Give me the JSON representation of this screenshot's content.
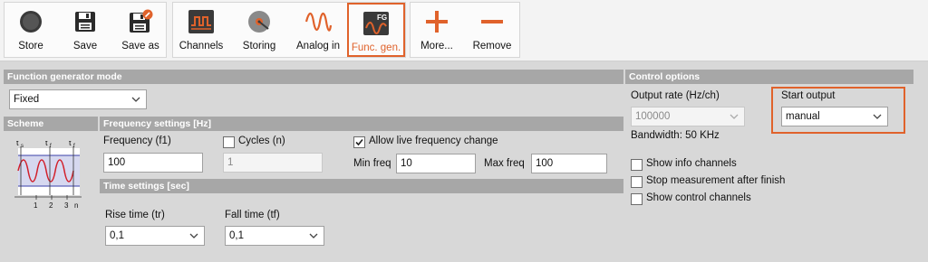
{
  "toolbar": {
    "store": "Store",
    "save": "Save",
    "save_as": "Save as",
    "channels": "Channels",
    "storing": "Storing",
    "analog_in": "Analog in",
    "func_gen": "Func. gen.",
    "func_gen_badge": "FG",
    "more": "More...",
    "remove": "Remove"
  },
  "fg_mode": {
    "title": "Function generator mode",
    "value": "Fixed"
  },
  "scheme": {
    "title": "Scheme",
    "labels": {
      "ts": "t",
      "ts_sub": "s",
      "tf": "t",
      "tf_sub": "f",
      "tf2": "t",
      "tf2_sub": "f",
      "n1": "1",
      "n2": "2",
      "n3": "3",
      "n": "n"
    }
  },
  "freq": {
    "title": "Frequency settings [Hz]",
    "frequency_label": "Frequency (f1)",
    "frequency_value": "100",
    "cycles_label": "Cycles (n)",
    "cycles_value": "1",
    "cycles_checked": false,
    "live_label": "Allow live frequency change",
    "live_checked": true,
    "min_label": "Min freq",
    "min_value": "10",
    "max_label": "Max freq",
    "max_value": "100"
  },
  "time": {
    "title": "Time settings [sec]",
    "rise_label": "Rise time (tr)",
    "rise_value": "0,1",
    "fall_label": "Fall time (tf)",
    "fall_value": "0,1"
  },
  "control": {
    "title": "Control options",
    "rate_label": "Output rate (Hz/ch)",
    "rate_value": "100000",
    "bandwidth": "Bandwidth: 50 KHz",
    "start_label": "Start output",
    "start_value": "manual",
    "info_channels": "Show info channels",
    "stop_after": "Stop measurement after finish",
    "control_channels": "Show control channels"
  },
  "colors": {
    "accent": "#e0622b",
    "section_bar": "#a7a7a7",
    "background": "#d8d8d8"
  }
}
